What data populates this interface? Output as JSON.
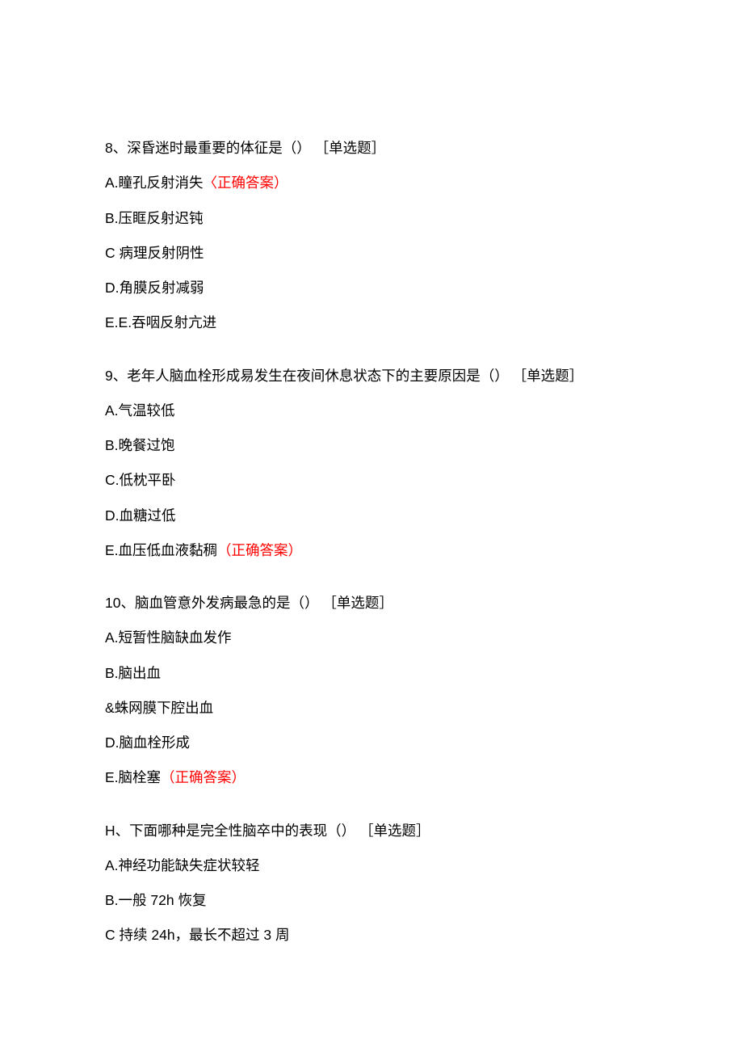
{
  "questions": [
    {
      "prompt": "8、深昏迷时最重要的体征是（） ［单选题］",
      "options": [
        {
          "pre": "A.",
          "mid": "瞳孔反射消失",
          "post": "〈正确答案）",
          "correct": true
        },
        {
          "pre": "B.",
          "mid": "压眶反射迟钝",
          "post": "",
          "correct": false
        },
        {
          "pre": "C ",
          "mid": "病理反射阴性",
          "post": "",
          "correct": false
        },
        {
          "pre": "D.",
          "mid": "角膜反射减弱",
          "post": "",
          "correct": false
        },
        {
          "pre": "E.E.",
          "mid": "吞咽反射亢进",
          "post": "",
          "correct": false
        }
      ]
    },
    {
      "prompt": "9、老年人脑血栓形成易发生在夜间休息状态下的主要原因是（） ［单选题］",
      "options": [
        {
          "pre": "A.",
          "mid": "气温较低",
          "post": "",
          "correct": false
        },
        {
          "pre": "B.",
          "mid": "晚餐过饱",
          "post": "",
          "correct": false
        },
        {
          "pre": "C.",
          "mid": "低枕平卧",
          "post": "",
          "correct": false
        },
        {
          "pre": "D.",
          "mid": "血糖过低",
          "post": "",
          "correct": false
        },
        {
          "pre": "E.",
          "mid": "血压低血液黏稠",
          "post": "（正确答案）",
          "correct": true
        }
      ]
    },
    {
      "prompt": "10、脑血管意外发病最急的是（） ［单选题］",
      "options": [
        {
          "pre": "A.",
          "mid": "短暂性脑缺血发作",
          "post": "",
          "correct": false
        },
        {
          "pre": "B.",
          "mid": "脑出血",
          "post": "",
          "correct": false
        },
        {
          "pre": "&",
          "mid": "蛛网膜下腔出血",
          "post": "",
          "correct": false
        },
        {
          "pre": "D.",
          "mid": "脑血栓形成",
          "post": "",
          "correct": false
        },
        {
          "pre": "E.",
          "mid": "脑栓塞",
          "post": "（正确答案）",
          "correct": true
        }
      ]
    },
    {
      "prompt": "H、下面哪种是完全性脑卒中的表现（） ［单选题］",
      "options": [
        {
          "pre": "A.",
          "mid": "神经功能缺失症状较轻",
          "post": "",
          "correct": false
        },
        {
          "pre": "B.",
          "mid": "一般 72h 恢复",
          "post": "",
          "correct": false
        },
        {
          "pre": "C ",
          "mid": "持续 24h，最长不超过 3 周",
          "post": "",
          "correct": false
        }
      ]
    }
  ]
}
